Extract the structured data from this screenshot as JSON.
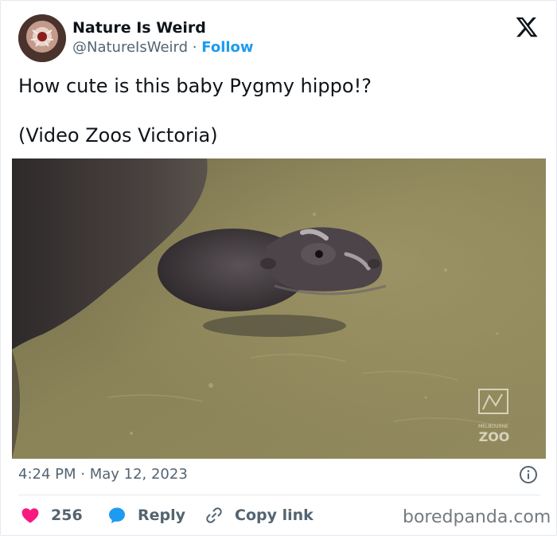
{
  "author": {
    "display_name": "Nature Is Weird",
    "handle": "@NatureIsWeird",
    "separator": "·",
    "follow_label": "Follow"
  },
  "tweet": {
    "line1": "How cute is this baby Pygmy hippo!?",
    "line2": "(Video Zoos Victoria)"
  },
  "media": {
    "watermark_top": "MELBOURNE",
    "watermark_bottom": "ZOO"
  },
  "meta": {
    "timestamp": "4:24 PM · May 12, 2023"
  },
  "actions": {
    "like_count": "256",
    "reply_label": "Reply",
    "copy_link_label": "Copy link"
  },
  "watermark": "boredpanda.com",
  "colors": {
    "link_blue": "#1d9bf0",
    "like_pink": "#f91880",
    "muted_text": "#536471"
  },
  "icons": {
    "brand": "x-logo-icon",
    "info": "info-icon",
    "like": "heart-icon",
    "reply": "speech-bubble-icon",
    "copy": "link-icon"
  }
}
